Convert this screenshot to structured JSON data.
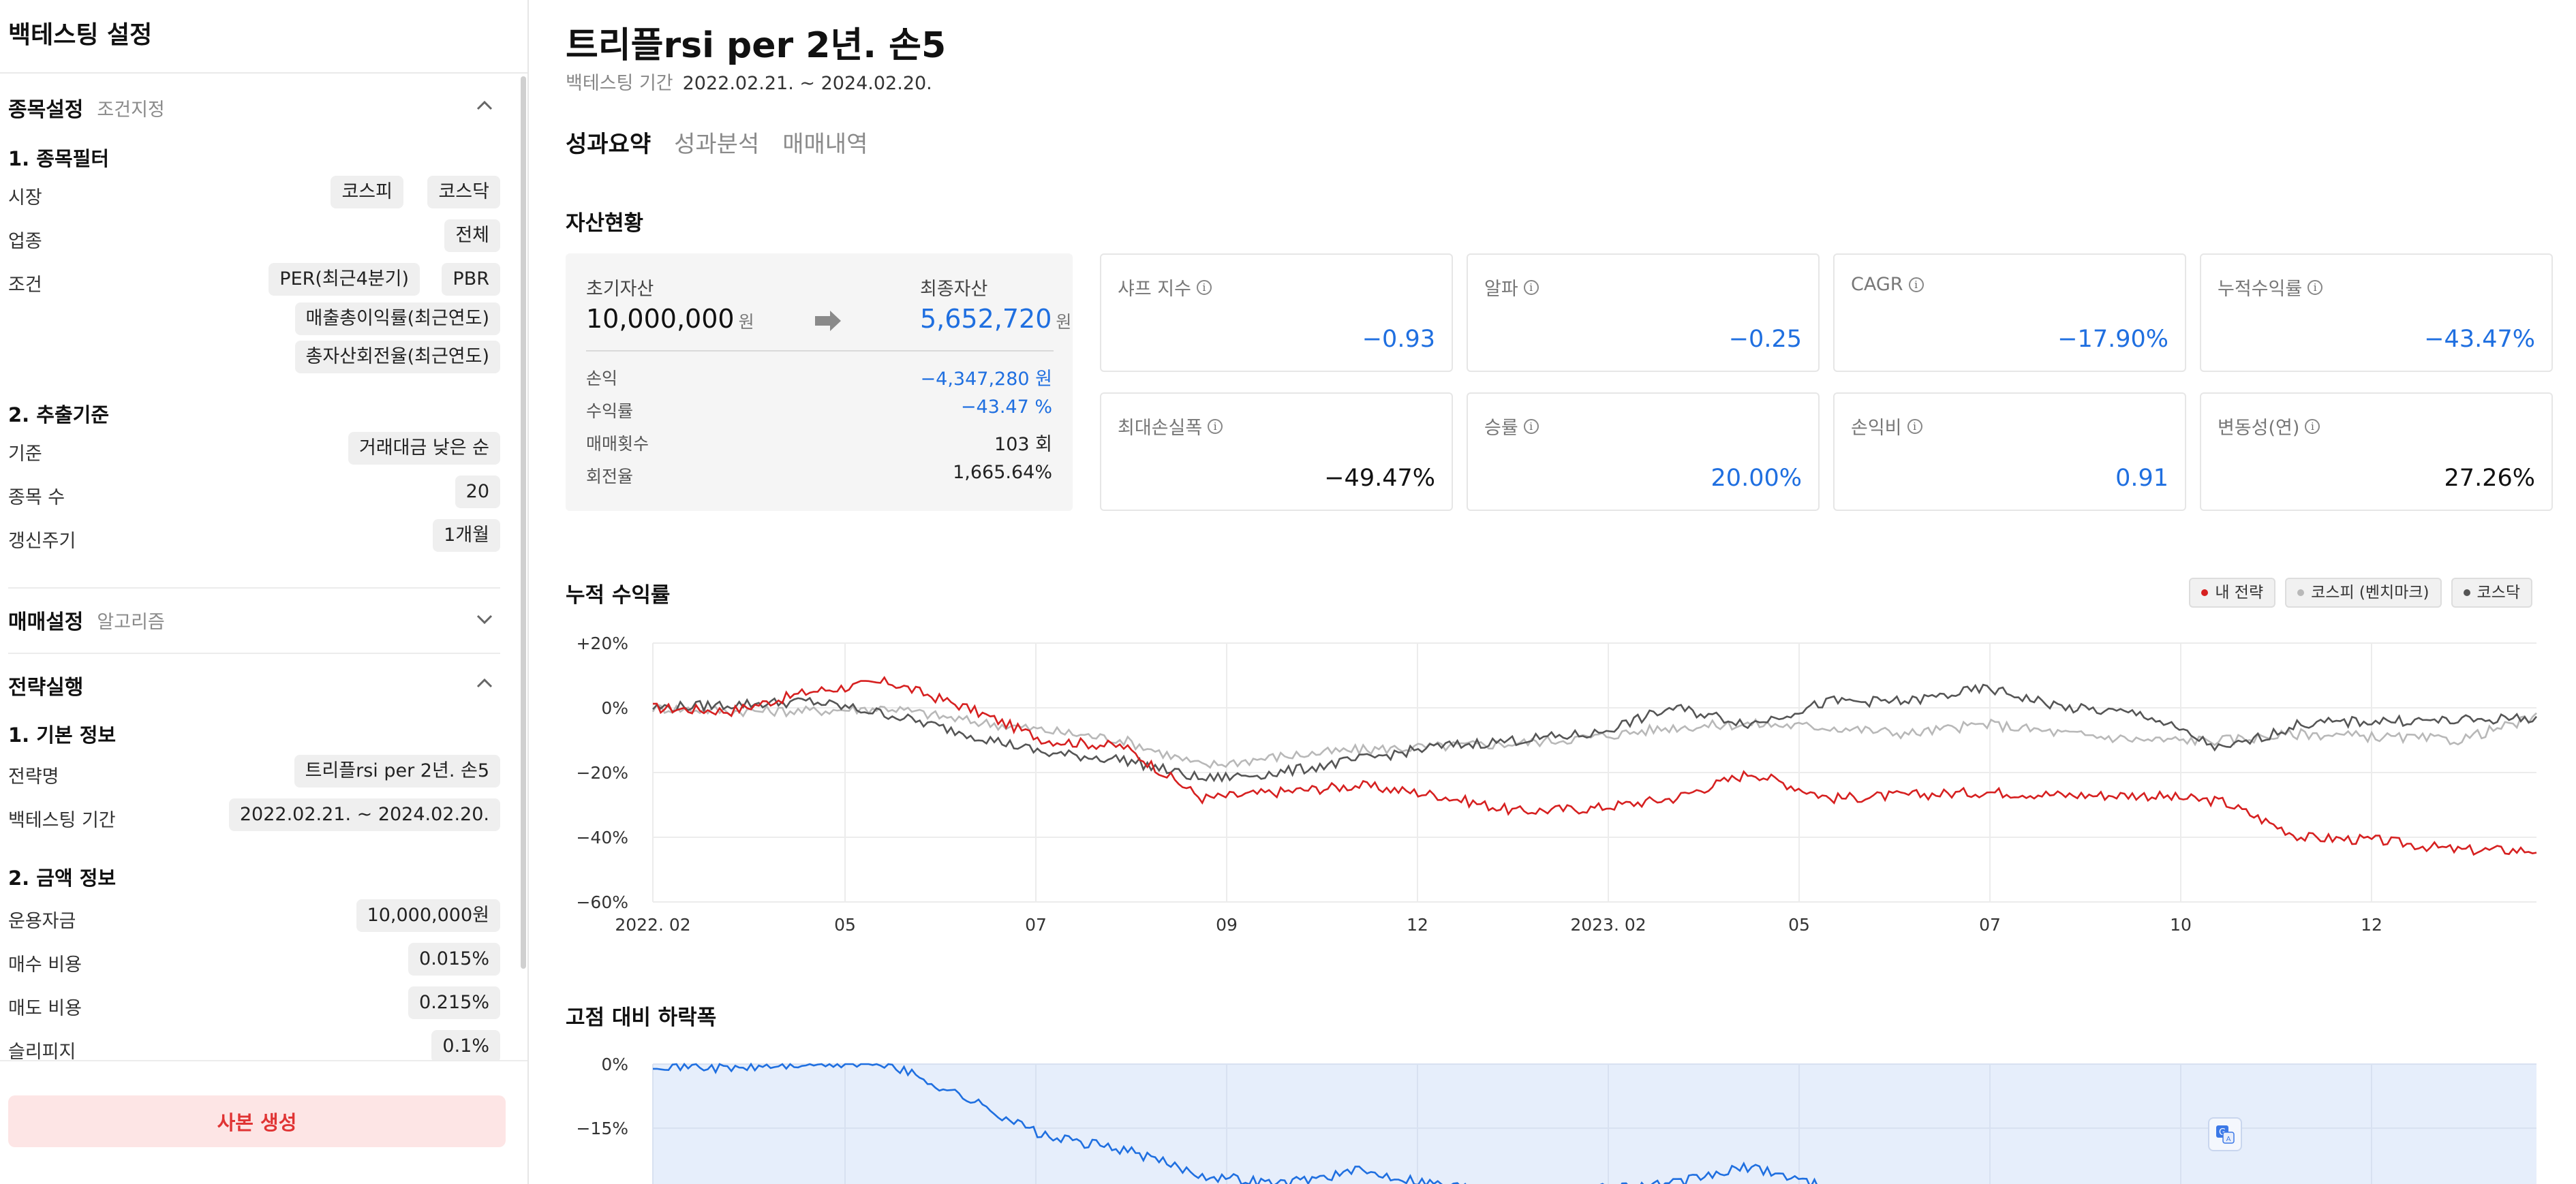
{
  "sidebar": {
    "title": "백테스팅 설정",
    "stock_section": {
      "title": "종목설정",
      "subtitle": "조건지정"
    },
    "filter": {
      "title": "1. 종목필터",
      "market_label": "시장",
      "market_values": [
        "코스피",
        "코스닥"
      ],
      "industry_label": "업종",
      "industry_value": "전체",
      "condition_label": "조건",
      "condition_values": [
        "PER(최근4분기)",
        "PBR",
        "매출총이익률(최근연도)",
        "총자산회전율(최근연도)"
      ]
    },
    "extract": {
      "title": "2. 추출기준",
      "basis_label": "기준",
      "basis_value": "거래대금 낮은 순",
      "count_label": "종목 수",
      "count_value": "20",
      "cycle_label": "갱신주기",
      "cycle_value": "1개월"
    },
    "trade_section": {
      "title": "매매설정",
      "subtitle": "알고리즘"
    },
    "run_section": {
      "title": "전략실행"
    },
    "basic": {
      "title": "1. 기본 정보",
      "name_label": "전략명",
      "name_value": "트리플rsi per 2년. 손5",
      "period_label": "백테스팅 기간",
      "period_value": "2022.02.21. ~ 2024.02.20."
    },
    "amount": {
      "title": "2. 금액 정보",
      "fund_label": "운용자금",
      "fund_value": "10,000,000원",
      "buy_label": "매수 비용",
      "buy_value": "0.015%",
      "sell_label": "매도 비용",
      "sell_value": "0.215%",
      "slip_label": "슬리피지",
      "slip_value": "0.1%"
    },
    "copy_button": "사본 생성"
  },
  "main": {
    "title": "트리플rsi per 2년. 손5",
    "period_label": "백테스팅 기간",
    "period_value": "2022.02.21. ~ 2024.02.20.",
    "tabs": [
      "성과요약",
      "성과분석",
      "매매내역"
    ],
    "asset_title": "자산현황",
    "asset": {
      "initial_label": "초기자산",
      "initial_value": "10,000,000",
      "unit": "원",
      "final_label": "최종자산",
      "final_value": "5,652,720",
      "rows": [
        {
          "label": "손익",
          "value": "−4,347,280 원"
        },
        {
          "label": "수익률",
          "value": "−43.47 %"
        },
        {
          "label": "매매횟수",
          "value": "103 회"
        },
        {
          "label": "회전율",
          "value": "1,665.64%"
        }
      ]
    },
    "metrics": [
      {
        "label": "샤프 지수",
        "value": "−0.93"
      },
      {
        "label": "알파",
        "value": "−0.25"
      },
      {
        "label": "CAGR",
        "value": "−17.90%"
      },
      {
        "label": "누적수익률",
        "value": "−43.47%"
      },
      {
        "label": "최대손실폭",
        "value": "−49.47%"
      },
      {
        "label": "승률",
        "value": "20.00%"
      },
      {
        "label": "손익비",
        "value": "0.91"
      },
      {
        "label": "변동성(연)",
        "value": "27.26%"
      }
    ],
    "cum_title": "누적 수익률",
    "drawdown_title": "고점 대비 하락폭",
    "legend": [
      "내 전략",
      "코스피 (벤치마크)",
      "코스닥"
    ]
  },
  "colors": {
    "strategy": "#d62020",
    "kospi": "#b8b8b8",
    "kosdaq": "#555555",
    "blue": "#1f6fe0",
    "drawdown_fill": "#e6eefb"
  },
  "chart_data": [
    {
      "type": "line",
      "title": "누적 수익률",
      "x_ticks": [
        "2022. 02",
        "05",
        "07",
        "09",
        "12",
        "2023. 02",
        "05",
        "07",
        "10",
        "12"
      ],
      "y_ticks": [
        "+20%",
        "0%",
        "−20%",
        "−40%",
        "−60%"
      ],
      "ylim": [
        -60,
        20
      ],
      "x": [
        "2022-02",
        "2022-03",
        "2022-04",
        "2022-05",
        "2022-06",
        "2022-07",
        "2022-08",
        "2022-09",
        "2022-10",
        "2022-11",
        "2022-12",
        "2023-01",
        "2023-02",
        "2023-03",
        "2023-04",
        "2023-05",
        "2023-06",
        "2023-07",
        "2023-08",
        "2023-09",
        "2023-10",
        "2023-11",
        "2023-12",
        "2024-01",
        "2024-02"
      ],
      "series": [
        {
          "name": "내 전략",
          "values": [
            0,
            -1,
            5,
            8,
            0,
            -10,
            -12,
            -28,
            -26,
            -24,
            -27,
            -32,
            -31,
            -28,
            -20,
            -28,
            -27,
            -26,
            -27,
            -27,
            -29,
            -40,
            -41,
            -44,
            -44
          ]
        },
        {
          "name": "코스피 (벤치마크)",
          "values": [
            0,
            -1,
            -1,
            0,
            -4,
            -7,
            -10,
            -18,
            -15,
            -13,
            -12,
            -11,
            -9,
            -6,
            -5,
            -6,
            -8,
            -5,
            -8,
            -10,
            -10,
            -8,
            -9,
            -10,
            -3
          ]
        },
        {
          "name": "코스닥",
          "values": [
            0,
            1,
            2,
            -2,
            -8,
            -14,
            -16,
            -22,
            -20,
            -16,
            -12,
            -10,
            -8,
            0,
            -5,
            2,
            2,
            6,
            0,
            -2,
            -13,
            -5,
            -4,
            -4,
            -3
          ]
        }
      ],
      "grid": true,
      "legend": "top-right"
    },
    {
      "type": "area",
      "title": "고점 대비 하락폭",
      "y_ticks": [
        "0%",
        "−15%"
      ],
      "x": [
        "2022-02",
        "2022-03",
        "2022-04",
        "2022-05",
        "2022-06",
        "2022-07",
        "2022-08",
        "2022-09",
        "2022-10",
        "2022-11",
        "2022-12",
        "2023-01",
        "2023-02",
        "2023-03",
        "2023-04",
        "2023-05"
      ],
      "series": [
        {
          "name": "내 전략",
          "values": [
            0,
            -1,
            0,
            0,
            -8,
            -17,
            -20,
            -26,
            -28,
            -25,
            -28,
            -30,
            -29,
            -28,
            -24,
            -29
          ]
        }
      ],
      "grid": true
    }
  ]
}
